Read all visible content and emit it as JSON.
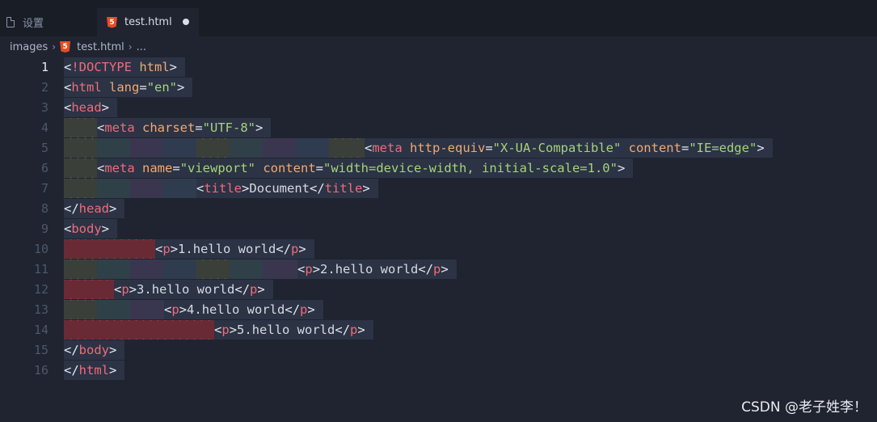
{
  "tabs": [
    {
      "label": "设置",
      "icon": "file-icon"
    },
    {
      "label": "test.html",
      "icon": "html5-icon",
      "dirty": true
    }
  ],
  "breadcrumb": {
    "folder": "images",
    "file": "test.html",
    "more": "..."
  },
  "editor": {
    "current_line": 1,
    "line_numbers": [
      "1",
      "2",
      "3",
      "4",
      "5",
      "6",
      "7",
      "8",
      "9",
      "10",
      "11",
      "12",
      "13",
      "14",
      "15",
      "16"
    ]
  },
  "code": {
    "l1": {
      "a": "<",
      "b": "!DOCTYPE",
      "c": " html",
      "d": ">"
    },
    "l2": {
      "a": "<",
      "b": "html",
      "c": " lang",
      "d": "=",
      "e": "\"en\"",
      "f": ">"
    },
    "l3": {
      "a": "<",
      "b": "head",
      "c": ">"
    },
    "l4": {
      "a": "<",
      "b": "meta",
      "c": " charset",
      "d": "=",
      "e": "\"UTF-8\"",
      "f": ">"
    },
    "l5": {
      "a": "<",
      "b": "meta",
      "c": " http-equiv",
      "d": "=",
      "e": "\"X-UA-Compatible\"",
      "f": " content",
      "g": "=",
      "h": "\"IE=edge\"",
      "i": ">"
    },
    "l6": {
      "a": "<",
      "b": "meta",
      "c": " name",
      "d": "=",
      "e": "\"viewport\"",
      "f": " content",
      "g": "=",
      "h": "\"width=device-width, initial-scale=1.0\"",
      "i": ">"
    },
    "l7": {
      "a": "<",
      "b": "title",
      "c": ">",
      "d": "Document",
      "e": "</",
      "f": "title",
      "g": ">"
    },
    "l8": {
      "a": "</",
      "b": "head",
      "c": ">"
    },
    "l9": {
      "a": "<",
      "b": "body",
      "c": ">"
    },
    "l10": {
      "a": "<",
      "b": "p",
      "c": ">",
      "d": "1.hello world",
      "e": "</",
      "f": "p",
      "g": ">"
    },
    "l11": {
      "a": "<",
      "b": "p",
      "c": ">",
      "d": "2.hello world",
      "e": "</",
      "f": "p",
      "g": ">"
    },
    "l12": {
      "a": "<",
      "b": "p",
      "c": ">",
      "d": "3.hello world",
      "e": "</",
      "f": "p",
      "g": ">"
    },
    "l13": {
      "a": "<",
      "b": "p",
      "c": ">",
      "d": "4.hello world",
      "e": "</",
      "f": "p",
      "g": ">"
    },
    "l14": {
      "a": "<",
      "b": "p",
      "c": ">",
      "d": "5.hello world",
      "e": "</",
      "f": "p",
      "g": ">"
    },
    "l15": {
      "a": "</",
      "b": "body",
      "c": ">"
    },
    "l16": {
      "a": "</",
      "b": "html",
      "c": ">"
    }
  },
  "watermark": "CSDN @老子姓李！",
  "colors": {
    "editor_bg": "#1f2430",
    "tag": "#f06b78",
    "attribute": "#f5a86e",
    "string": "#a7d37a",
    "indent_error": "#6a2a35"
  }
}
